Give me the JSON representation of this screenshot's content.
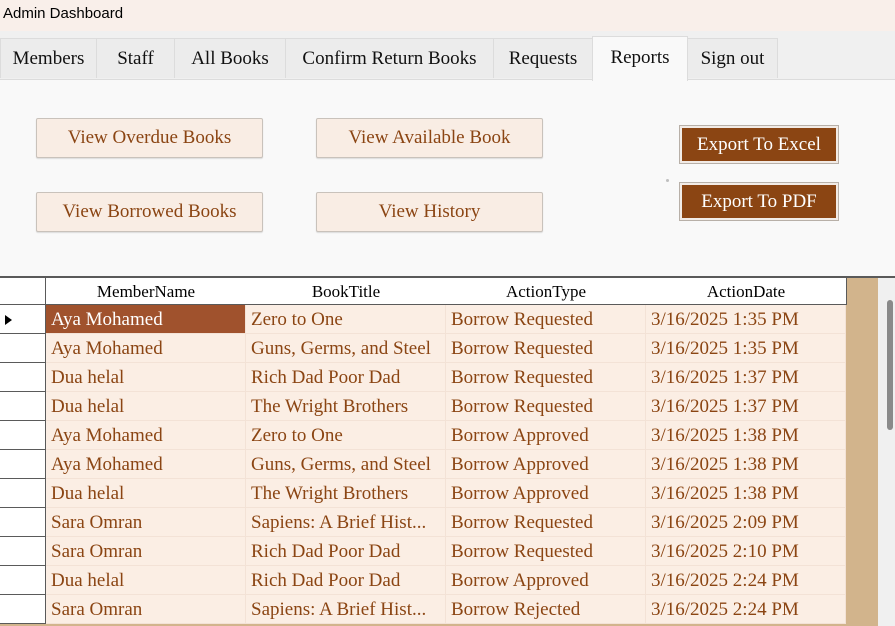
{
  "window": {
    "title": "Admin Dashboard"
  },
  "tabs": [
    {
      "label": "Members"
    },
    {
      "label": "Staff"
    },
    {
      "label": "All Books"
    },
    {
      "label": "Confirm Return Books"
    },
    {
      "label": "Requests"
    },
    {
      "label": "Reports",
      "active": true
    },
    {
      "label": "Sign out"
    }
  ],
  "reports": {
    "view_overdue": "View Overdue Books",
    "view_available": "View Available Book",
    "view_borrowed": "View Borrowed Books",
    "view_history": "View History",
    "export_excel": "Export To Excel",
    "export_pdf": "Export To PDF"
  },
  "grid": {
    "columns": [
      "MemberName",
      "BookTitle",
      "ActionType",
      "ActionDate"
    ],
    "selected_row": 0,
    "rows": [
      [
        "Aya Mohamed",
        "Zero to One",
        "Borrow Requested",
        "3/16/2025 1:35 PM"
      ],
      [
        "Aya Mohamed",
        "Guns, Germs, and Steel",
        "Borrow Requested",
        "3/16/2025 1:35 PM"
      ],
      [
        "Dua helal",
        "Rich Dad Poor Dad",
        "Borrow Requested",
        "3/16/2025 1:37 PM"
      ],
      [
        "Dua helal",
        "The Wright Brothers",
        "Borrow Requested",
        "3/16/2025 1:37 PM"
      ],
      [
        "Aya Mohamed",
        "Zero to One",
        "Borrow Approved",
        "3/16/2025 1:38 PM"
      ],
      [
        "Aya Mohamed",
        "Guns, Germs, and Steel",
        "Borrow Approved",
        "3/16/2025 1:38 PM"
      ],
      [
        "Dua helal",
        "The Wright Brothers",
        "Borrow Approved",
        "3/16/2025 1:38 PM"
      ],
      [
        "Sara Omran",
        "Sapiens: A Brief Hist...",
        "Borrow Requested",
        "3/16/2025 2:09 PM"
      ],
      [
        "Sara Omran",
        "Rich Dad Poor Dad",
        "Borrow Requested",
        "3/16/2025 2:10 PM"
      ],
      [
        "Dua helal",
        "Rich Dad Poor Dad",
        "Borrow Approved",
        "3/16/2025 2:24 PM"
      ],
      [
        "Sara Omran",
        "Sapiens: A Brief Hist...",
        "Borrow Rejected",
        "3/16/2025 2:24 PM"
      ]
    ]
  },
  "colors": {
    "accent": "#8b4513",
    "selection": "#a0522d",
    "row_bg": "#fbeee4",
    "grid_bg": "#d2b48c"
  }
}
